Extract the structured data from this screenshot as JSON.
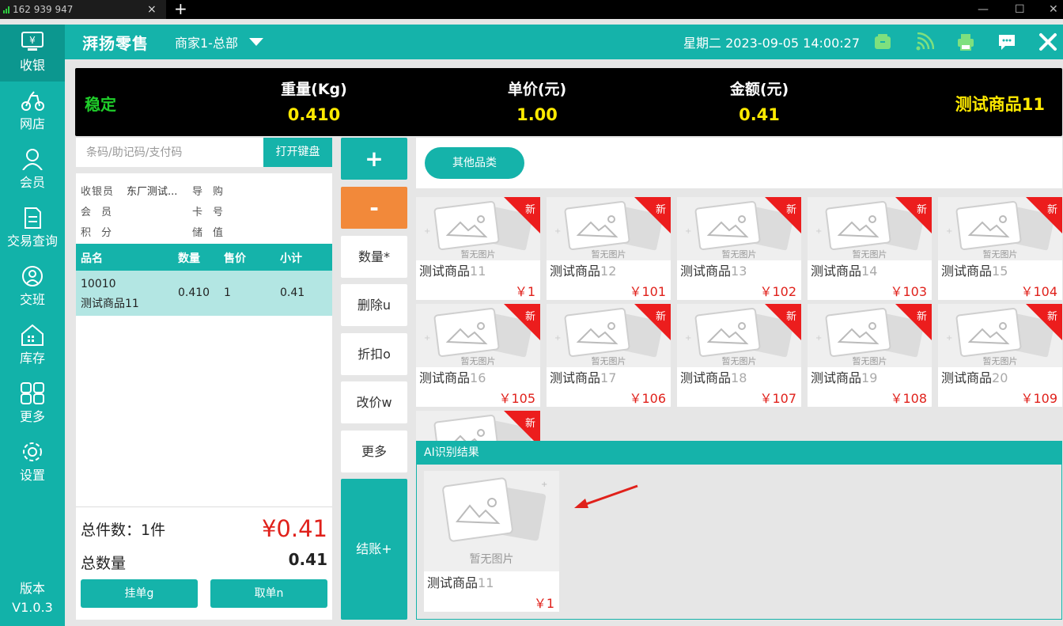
{
  "window": {
    "tab_title": "162 939 947",
    "tab_close": "×",
    "new_tab": "+",
    "minimize": "—",
    "maximize": "☐",
    "close": "✕"
  },
  "sidebar": {
    "items": [
      {
        "label": "收银",
        "icon": "cashier-icon"
      },
      {
        "label": "网店",
        "icon": "online-store-icon"
      },
      {
        "label": "会员",
        "icon": "member-icon"
      },
      {
        "label": "交易查询",
        "icon": "transaction-query-icon"
      },
      {
        "label": "交班",
        "icon": "shift-handover-icon"
      },
      {
        "label": "库存",
        "icon": "inventory-icon"
      },
      {
        "label": "更多",
        "icon": "more-grid-icon"
      },
      {
        "label": "设置",
        "icon": "settings-gear-icon"
      }
    ],
    "version_label": "版本",
    "version": "V1.0.3"
  },
  "header": {
    "logo": "湃扬零售",
    "merchant": "商家1-总部",
    "datetime": "星期二 2023-09-05 14:00:27",
    "icons": [
      "wallet-icon",
      "wifi-icon",
      "printer-icon",
      "message-icon",
      "close-icon"
    ]
  },
  "scale": {
    "status": "稳定",
    "weight_label": "重量(Kg)",
    "weight": "0.410",
    "unit_price_label": "单价(元)",
    "unit_price": "1.00",
    "amount_label": "金额(元)",
    "amount": "0.41",
    "product": "测试商品11"
  },
  "search": {
    "placeholder": "条码/助记码/支付码",
    "keyboard_button": "打开键盘"
  },
  "info": {
    "cashier_label": "收银员",
    "cashier": "东厂测试...",
    "guide_label": "导　购",
    "member_label": "会　员",
    "card_label": "卡　号",
    "points_label": "积　分",
    "balance_label": "储　值"
  },
  "cart": {
    "headers": [
      "品名",
      "数量",
      "售价",
      "小计"
    ],
    "rows": [
      {
        "code": "10010",
        "name": "测试商品11",
        "qty": "0.410",
        "price": "1",
        "subtotal": "0.41"
      }
    ]
  },
  "totals": {
    "count_label": "总件数：1件",
    "amount": "¥0.41",
    "qty_label": "总数量",
    "qty": "0.41",
    "hang_button": "挂单g",
    "recall_button": "取单n"
  },
  "actions": {
    "plus": "+",
    "minus": "-",
    "quantity": "数量*",
    "delete": "删除u",
    "discount": "折扣o",
    "change_price": "改价w",
    "more": "更多",
    "checkout": "结账+"
  },
  "category": {
    "button": "其他品类"
  },
  "products": [
    {
      "name": "测试商品",
      "num": "11",
      "price": "￥1",
      "badge": "新"
    },
    {
      "name": "测试商品",
      "num": "12",
      "price": "￥101",
      "badge": "新"
    },
    {
      "name": "测试商品",
      "num": "13",
      "price": "￥102",
      "badge": "新"
    },
    {
      "name": "测试商品",
      "num": "14",
      "price": "￥103",
      "badge": "新"
    },
    {
      "name": "测试商品",
      "num": "15",
      "price": "￥104",
      "badge": "新"
    },
    {
      "name": "测试商品",
      "num": "16",
      "price": "￥105",
      "badge": "新"
    },
    {
      "name": "测试商品",
      "num": "17",
      "price": "￥106",
      "badge": "新"
    },
    {
      "name": "测试商品",
      "num": "18",
      "price": "￥107",
      "badge": "新"
    },
    {
      "name": "测试商品",
      "num": "19",
      "price": "￥108",
      "badge": "新"
    },
    {
      "name": "测试商品",
      "num": "20",
      "price": "￥109",
      "badge": "新"
    },
    {
      "name": "",
      "num": "",
      "price": "",
      "badge": "新"
    }
  ],
  "placeholder_image_text": "暂无图片",
  "ai": {
    "title": "AI识别结果",
    "result": {
      "name": "测试商品",
      "num": "11",
      "price": "￥1",
      "no_image": "暂无图片"
    }
  },
  "colors": {
    "brand": "#15b3aa",
    "sidebar_active": "#0c978f",
    "price_red": "#e0211b",
    "scale_yellow": "#ffea00",
    "stable_green": "#1fcf2a",
    "minus_orange": "#f2893a"
  }
}
